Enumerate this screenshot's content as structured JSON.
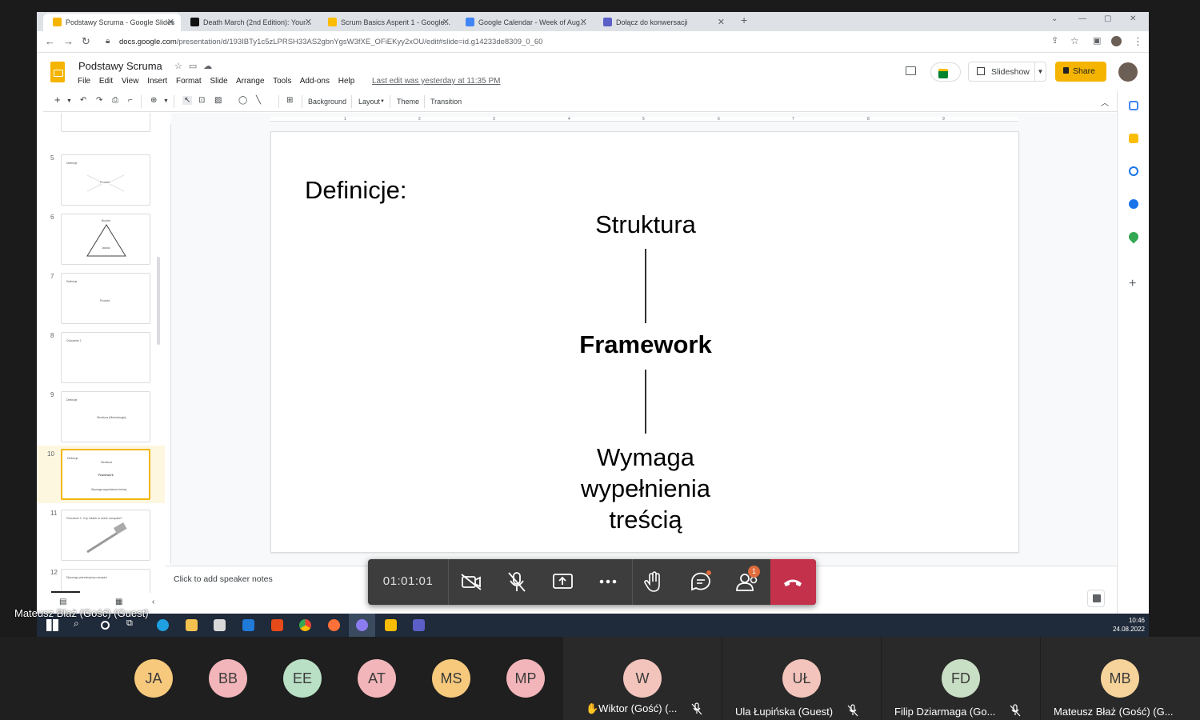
{
  "browser": {
    "tabs": [
      {
        "title": "Podstawy Scruma - Google Slides",
        "color": "#f4b400"
      },
      {
        "title": "Death March (2nd Edition): Your...",
        "color": "#ff9900"
      },
      {
        "title": "Scrum Basics Asperit 1 - Google...",
        "color": "#fbbc04"
      },
      {
        "title": "Google Calendar - Week of Aug...",
        "color": "#4285f4"
      },
      {
        "title": "Dołącz do konwersacji",
        "color": "#5b5fc7"
      }
    ],
    "url_host": "docs.google.com",
    "url_path": "/presentation/d/193IBTy1c5zLPRSH33AS2gbnYgsW3fXE_OFiEKyy2xOU/edit#slide=id.g14233de8309_0_60"
  },
  "docs": {
    "title": "Podstawy Scruma",
    "menu": [
      "File",
      "Edit",
      "View",
      "Insert",
      "Format",
      "Slide",
      "Arrange",
      "Tools",
      "Add-ons",
      "Help"
    ],
    "last_edit": "Last edit was yesterday at 11:35 PM",
    "slideshow_label": "Slideshow",
    "share_label": "Share",
    "toolbar": {
      "background": "Background",
      "layout": "Layout",
      "theme": "Theme",
      "transition": "Transition"
    }
  },
  "filmstrip": [
    {
      "num": "5",
      "lines": [
        "Definicje",
        "Produkt"
      ]
    },
    {
      "num": "6",
      "lines": [
        "Budżet",
        "Jakość"
      ]
    },
    {
      "num": "7",
      "lines": [
        "Definicje",
        "Produkt"
      ]
    },
    {
      "num": "8",
      "lines": [
        "Ćwiczenie 1"
      ]
    },
    {
      "num": "9",
      "lines": [
        "Definicje",
        "Struktura (Metodologia)"
      ]
    },
    {
      "num": "10",
      "lines": [
        "Definicje",
        "Struktura",
        "Framework",
        "Wymaga wypełnienia treścią"
      ]
    },
    {
      "num": "11",
      "lines": [
        "Ćwiczenie 2. Czy młotek to dobre narzędzie?"
      ]
    },
    {
      "num": "12",
      "lines": [
        "Dlaczego potrzebujemy narzędzi"
      ]
    }
  ],
  "slide": {
    "heading": "Definicje:",
    "top": "Struktura",
    "middle": "Framework",
    "bottom_lines": [
      "Wymaga",
      "wypełnienia",
      "treścią"
    ]
  },
  "notes_placeholder": "Click to add speaker notes",
  "ruler_ticks": [
    "1",
    "2",
    "3",
    "4",
    "5",
    "6",
    "7",
    "8",
    "9"
  ],
  "taskbar": {
    "time": "10:46",
    "date": "24.08.2022"
  },
  "meeting": {
    "timer": "01:01:01",
    "badge_count": "1",
    "presenter_name": "Mateusz Błaż (Gość) (Guest)",
    "participants_initials": [
      {
        "initials": "JA",
        "color": "#f6c97d"
      },
      {
        "initials": "BB",
        "color": "#f2b5ba"
      },
      {
        "initials": "EE",
        "color": "#b9dfc5"
      },
      {
        "initials": "AT",
        "color": "#f2b5ba"
      },
      {
        "initials": "MS",
        "color": "#f6c97d"
      },
      {
        "initials": "MP",
        "color": "#f2b5ba"
      }
    ],
    "participants_named": [
      {
        "initials": "W",
        "name": "✋Wiktor (Gość) (...",
        "color": "#f2c4bc"
      },
      {
        "initials": "UŁ",
        "name": "Ula Łupińska (Guest)",
        "color": "#f2c4bc"
      },
      {
        "initials": "FD",
        "name": "Filip Dziarmaga (Go...",
        "color": "#c9dfc5"
      },
      {
        "initials": "MB",
        "name": "Mateusz Błaż (Gość) (G...",
        "color": "#f6d39a"
      }
    ]
  }
}
